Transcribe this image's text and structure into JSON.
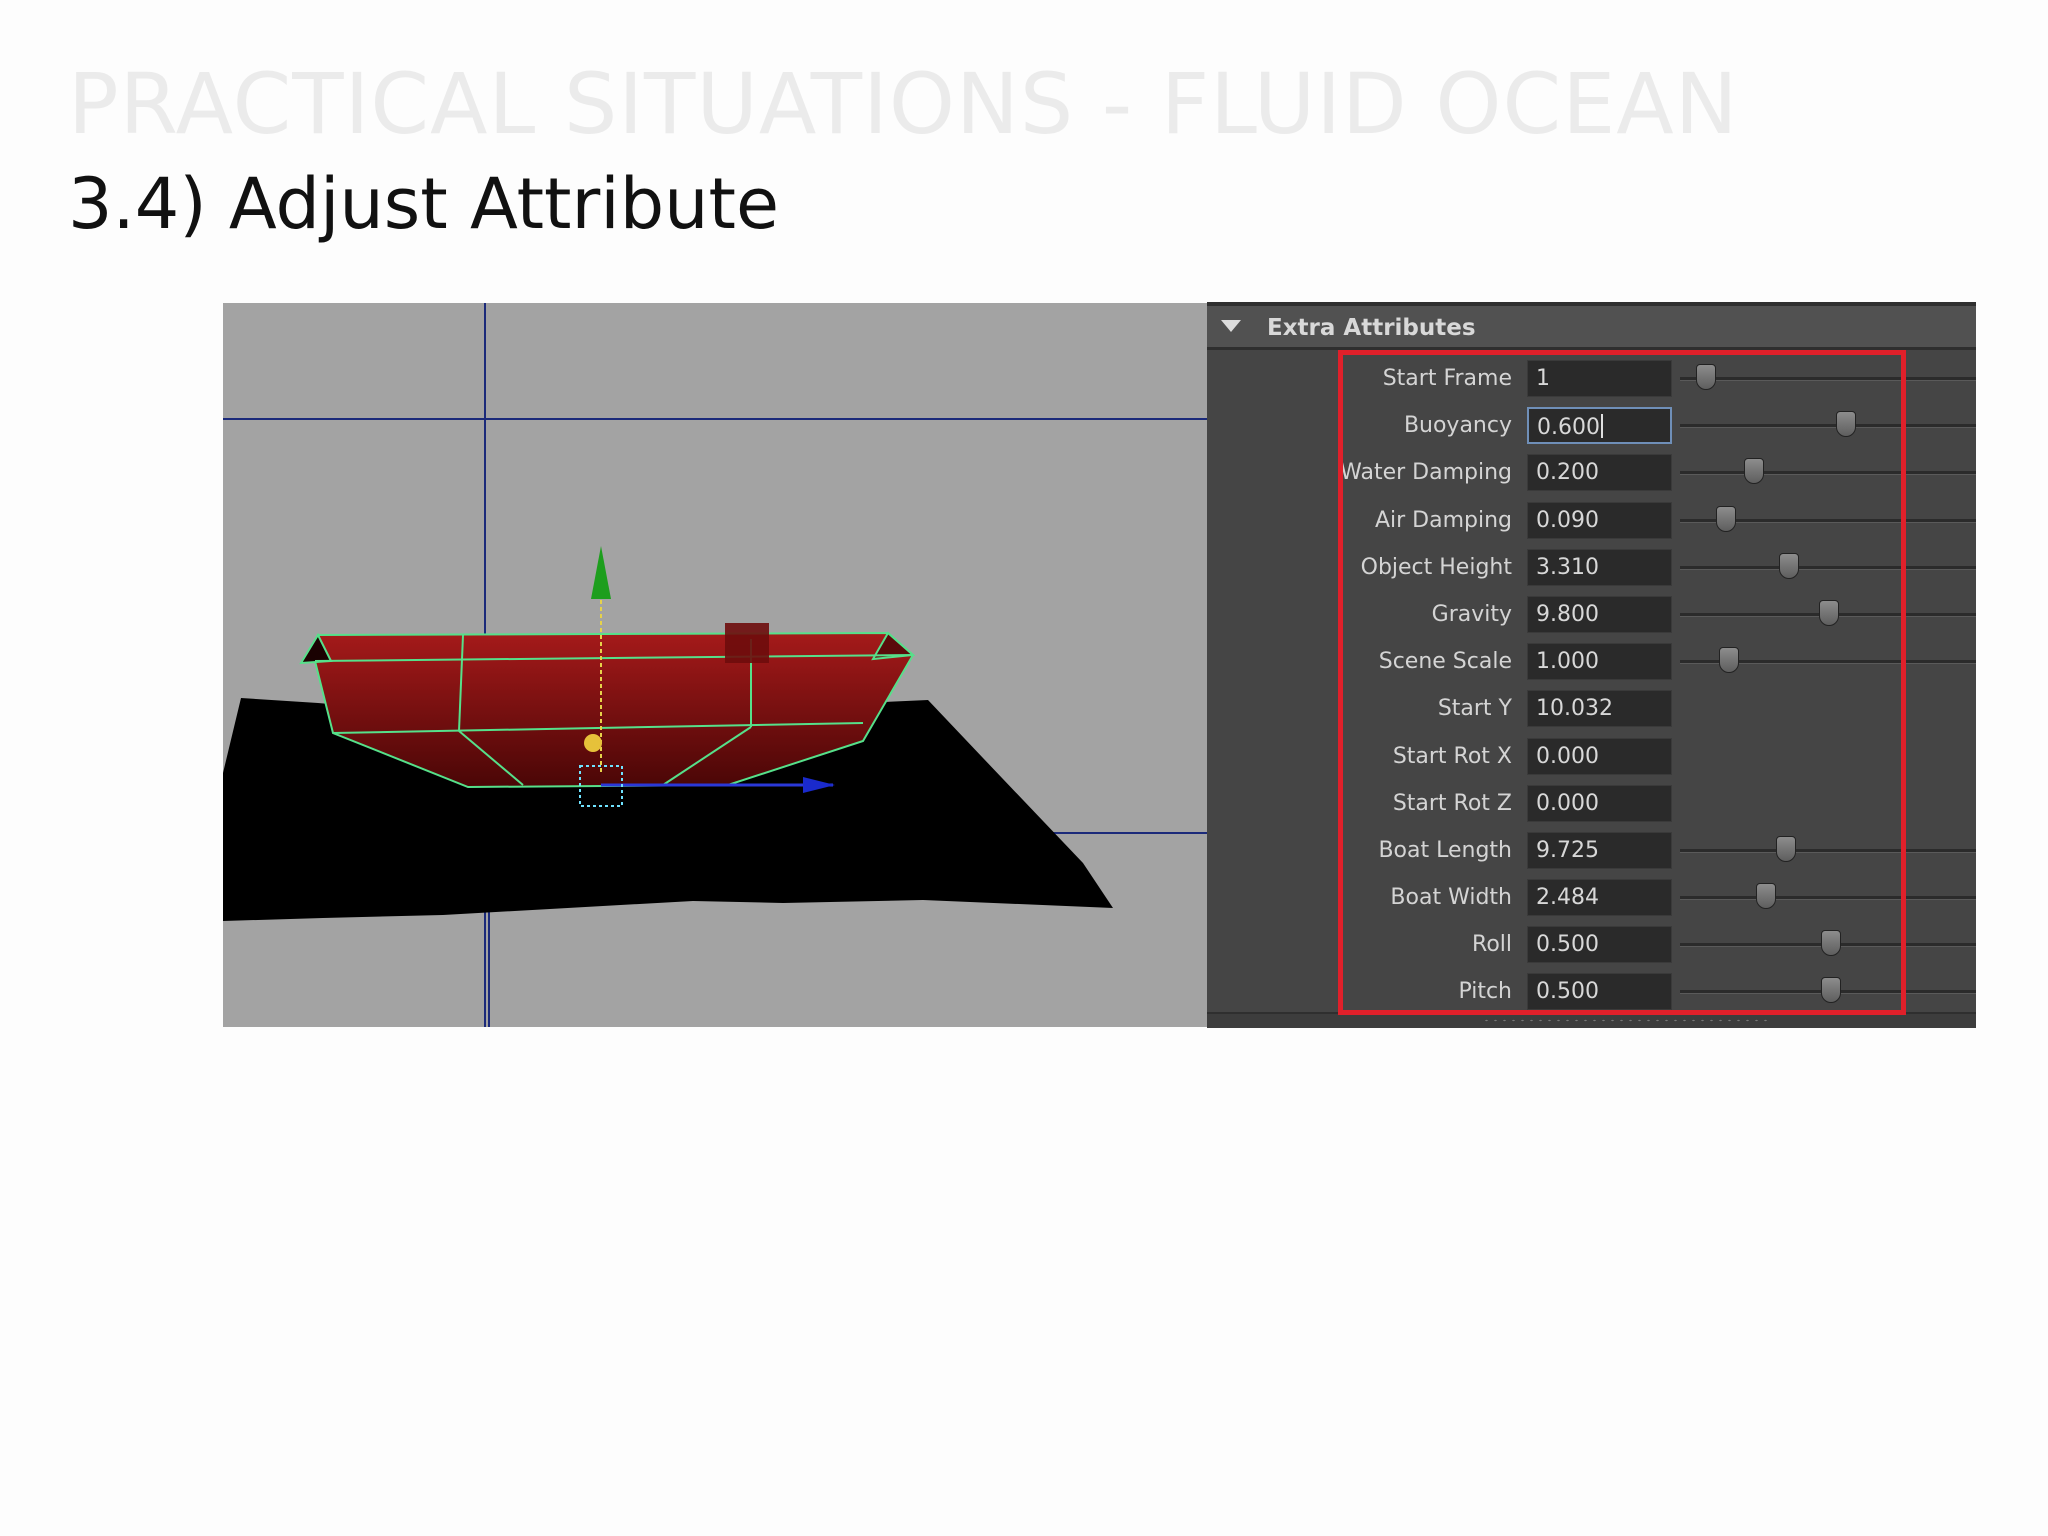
{
  "slide": {
    "heading": "PRACTICAL SITUATIONS - FLUID OCEAN",
    "subheading": "3.4) Adjust Attribute"
  },
  "panel": {
    "section_title": "Extra Attributes",
    "attributes": [
      {
        "label": "Start Frame",
        "value": "1",
        "slider": 0.04
      },
      {
        "label": "Buoyancy",
        "value": "0.600",
        "slider": 0.6,
        "focused": true
      },
      {
        "label": "Water Damping",
        "value": "0.200",
        "slider": 0.23
      },
      {
        "label": "Air Damping",
        "value": "0.090",
        "slider": 0.12
      },
      {
        "label": "Object Height",
        "value": "3.310",
        "slider": 0.37
      },
      {
        "label": "Gravity",
        "value": "9.800",
        "slider": 0.53
      },
      {
        "label": "Scene Scale",
        "value": "1.000",
        "slider": 0.13
      },
      {
        "label": "Start Y",
        "value": "10.032"
      },
      {
        "label": "Start Rot X",
        "value": "0.000"
      },
      {
        "label": "Start Rot Z",
        "value": "0.000"
      },
      {
        "label": "Boat Length",
        "value": "9.725",
        "slider": 0.36
      },
      {
        "label": "Boat Width",
        "value": "2.484",
        "slider": 0.28
      },
      {
        "label": "Roll",
        "value": "0.500",
        "slider": 0.54
      },
      {
        "label": "Pitch",
        "value": "0.500",
        "slider": 0.54
      }
    ]
  },
  "colors": {
    "highlight": "#e0202a",
    "hull": "#8e1414",
    "wireframe": "#55e28a",
    "ocean": "#000000",
    "viewport_bg": "#a3a3a3"
  },
  "icons": [
    "collapse-triangle-icon",
    "slider-handle-icon",
    "move-manipulator-icon"
  ]
}
